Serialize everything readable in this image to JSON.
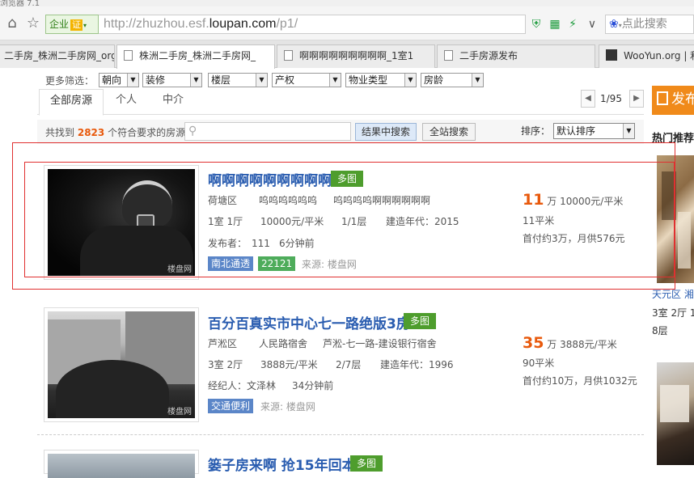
{
  "window": {
    "titlebar_fragment": "浏览器 7.1"
  },
  "address_bar": {
    "enterprise_label": "企业",
    "cert_label": "证",
    "url_prefix": "http://zhuzhou.esf.",
    "url_domain": "loupan.com",
    "url_path": "/p1/",
    "search_placeholder": "点此搜索"
  },
  "tabs": [
    {
      "label": "二手房_株洲二手房网_org"
    },
    {
      "label": "株洲二手房_株洲二手房网_"
    },
    {
      "label": "啊啊啊啊啊啊啊啊啊_1室1"
    },
    {
      "label": "二手房源发布"
    },
    {
      "label": "WooYun.org | 利"
    }
  ],
  "filters": {
    "label": "更多筛选：",
    "selects": [
      "朝向",
      "装修",
      "楼层",
      "产权",
      "物业类型",
      "房龄"
    ]
  },
  "page_tabs": [
    "全部房源",
    "个人",
    "中介"
  ],
  "pager": {
    "text": "1/95"
  },
  "summary": {
    "prefix": "共找到",
    "count": "2823",
    "suffix": "个符合要求的房源",
    "search_in_results": "结果中搜索",
    "site_search": "全站搜索",
    "sort_label": "排序：",
    "sort_value": "默认排序"
  },
  "sidebar": {
    "orange_label": "发布",
    "hot_title": "热门推荐",
    "item1_loc": "天元区  湘",
    "item1_rooms": "3室 2厅 1",
    "item1_floor": "8层"
  },
  "listings": [
    {
      "title": "啊啊啊啊啊啊啊啊啊",
      "multi_tag": "多图",
      "district": "荷塘区",
      "community": "呜呜呜呜呜呜",
      "address": "呜呜呜呜啊啊啊啊啊啊",
      "rooms": "1室 1厅",
      "unit_price": "10000元/平米",
      "floor": "1/1层",
      "year": "建造年代：2015",
      "poster_label": "发布者：",
      "poster": "111",
      "time": "6分钟前",
      "tag1": "南北通透",
      "tag2": "22121",
      "source": "来源: 楼盘网",
      "price": "11",
      "price_unit": "万",
      "price_per": "10000元/平米",
      "area": "11平米",
      "payment": "首付约3万，月供576元",
      "watermark": "楼盘网"
    },
    {
      "title": "百分百真实市中心七一路绝版3房",
      "multi_tag": "多图",
      "district": "芦淞区",
      "community": "人民路宿舍",
      "address": "芦淞-七一路-建设银行宿舍",
      "rooms": "3室 2厅",
      "unit_price": "3888元/平米",
      "floor": "2/7层",
      "year": "建造年代：1996",
      "poster_label": "经纪人：",
      "poster": "文泽林",
      "time": "34分钟前",
      "tag1": "交通便利",
      "source": "来源: 楼盘网",
      "price": "35",
      "price_unit": "万",
      "price_per": "3888元/平米",
      "area": "90平米",
      "payment": "首付约10万，月供1032元",
      "watermark": "楼盘网"
    },
    {
      "title": "篓子房来啊 抢15年回本",
      "multi_tag": "多图"
    }
  ]
}
